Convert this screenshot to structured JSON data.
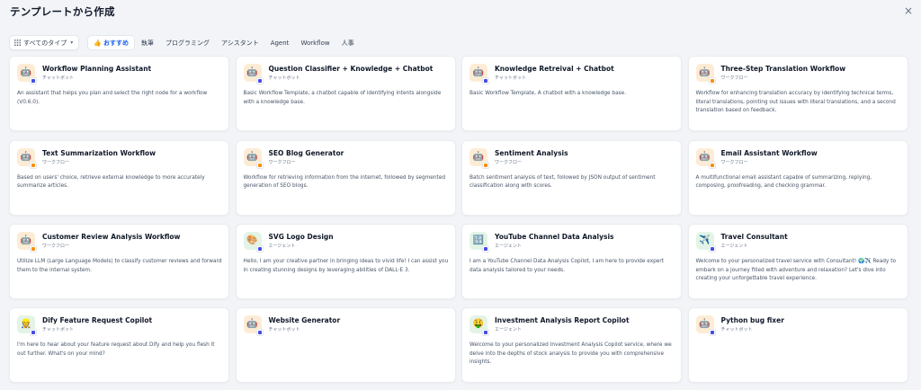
{
  "dialog": {
    "title": "テンプレートから作成",
    "close_glyph": "×"
  },
  "filters": {
    "type_select_label": "すべてのタイプ",
    "tabs": [
      {
        "label": "おすすめ",
        "active": true
      },
      {
        "label": "執筆",
        "active": false
      },
      {
        "label": "プログラミング",
        "active": false
      },
      {
        "label": "アシスタント",
        "active": false
      },
      {
        "label": "Agent",
        "active": false
      },
      {
        "label": "Workflow",
        "active": false
      },
      {
        "label": "人事",
        "active": false
      }
    ]
  },
  "templates": [
    {
      "name": "Workflow Planning Assistant",
      "mode": "チャットボット",
      "icon": "robot-icon",
      "glyph": "🤖",
      "bg": "#fdecd5",
      "badge": "#444ce7",
      "desc": "An assistant that helps you plan and select the right node for a workflow (V0.6.0)."
    },
    {
      "name": "Question Classifier + Knowledge + Chatbot",
      "mode": "チャットボット",
      "icon": "robot-icon",
      "glyph": "🤖",
      "bg": "#fdecd5",
      "badge": "#444ce7",
      "desc": "Basic Workflow Template, a chatbot capable of identifying intents alongside with a knowledge base."
    },
    {
      "name": "Knowledge Retreival + Chatbot",
      "mode": "チャットボット",
      "icon": "robot-icon",
      "glyph": "🤖",
      "bg": "#fdecd5",
      "badge": "#444ce7",
      "desc": "Basic Workflow Template, A chatbot with a knowledge base."
    },
    {
      "name": "Three-Step Translation Workflow",
      "mode": "ワークフロー",
      "icon": "robot-icon",
      "glyph": "🤖",
      "bg": "#fdecd5",
      "badge": "#f79009",
      "desc": "Workflow for enhancing translation accuracy by identifying technical terms, literal translations, pointing out issues with literal translations, and a second translation based on feedback."
    },
    {
      "name": "Text Summarization Workflow",
      "mode": "ワークフロー",
      "icon": "robot-icon",
      "glyph": "🤖",
      "bg": "#fdecd5",
      "badge": "#f79009",
      "desc": "Based on users' choice, retrieve external knowledge to more accurately summarize articles."
    },
    {
      "name": "SEO Blog Generator",
      "mode": "ワークフロー",
      "icon": "robot-icon",
      "glyph": "🤖",
      "bg": "#fdecd5",
      "badge": "#f79009",
      "desc": "Workflow for retrieving information from the internet, followed by segmented generation of SEO blogs."
    },
    {
      "name": "Sentiment Analysis",
      "mode": "ワークフロー",
      "icon": "robot-icon",
      "glyph": "🤖",
      "bg": "#fdecd5",
      "badge": "#f79009",
      "desc": "Batch sentiment analysis of text, followed by JSON output of sentiment classification along with scores."
    },
    {
      "name": "Email Assistant Workflow",
      "mode": "ワークフロー",
      "icon": "robot-icon",
      "glyph": "🤖",
      "bg": "#fdecd5",
      "badge": "#f79009",
      "desc": "A multifunctional email assistant capable of summarizing, replying, composing, proofreading, and checking grammar."
    },
    {
      "name": "Customer Review Analysis Workflow",
      "mode": "ワークフロー",
      "icon": "robot-icon",
      "glyph": "🤖",
      "bg": "#fdecd5",
      "badge": "#f79009",
      "desc": "Utilize LLM (Large Language Models) to classify customer reviews and forward them to the internal system."
    },
    {
      "name": "SVG Logo Design",
      "mode": "エージェント",
      "icon": "palette-icon",
      "glyph": "🎨",
      "bg": "#e3f4e6",
      "badge": "#444ce7",
      "desc": "Hello, I am your creative partner in bringing ideas to vivid life! I can assist you in creating stunning designs by leveraging abilities of DALL·E 3."
    },
    {
      "name": "YouTube Channel Data Analysis",
      "mode": "エージェント",
      "icon": "chart-icon",
      "glyph": "🔢",
      "bg": "#e3f4e6",
      "badge": "#444ce7",
      "desc": "I am a YouTube Channel Data Analysis Copilot, I am here to provide expert data analysis tailored to your needs."
    },
    {
      "name": "Travel Consultant",
      "mode": "エージェント",
      "icon": "airplane-icon",
      "glyph": "✈️",
      "bg": "#e3f4e6",
      "badge": "#444ce7",
      "desc": "Welcome to your personalized travel service with Consultant! 🌍✈️ Ready to embark on a journey filled with adventure and relaxation? Let's dive into creating your unforgettable travel experience."
    },
    {
      "name": "Dify Feature Request Copilot",
      "mode": "チャットボット",
      "icon": "person-icon",
      "glyph": "👷",
      "bg": "#e3f4e6",
      "badge": "#444ce7",
      "desc": "I'm here to hear about your feature request about Dify and help you flesh it out further. What's on your mind?"
    },
    {
      "name": "Website Generator",
      "mode": "チャットボット",
      "icon": "robot-icon",
      "glyph": "🤖",
      "bg": "#fdecd5",
      "badge": "#444ce7",
      "desc": ""
    },
    {
      "name": "Investment Analysis Report Copilot",
      "mode": "エージェント",
      "icon": "money-icon",
      "glyph": "🤑",
      "bg": "#e3f4e6",
      "badge": "#444ce7",
      "desc": "Welcome to your personalized Investment Analysis Copilot service, where we delve into the depths of stock analysis to provide you with comprehensive insights."
    },
    {
      "name": "Python bug fixer",
      "mode": "チャットボット",
      "icon": "robot-icon",
      "glyph": "🤖",
      "bg": "#fdecd5",
      "badge": "#444ce7",
      "desc": ""
    }
  ]
}
